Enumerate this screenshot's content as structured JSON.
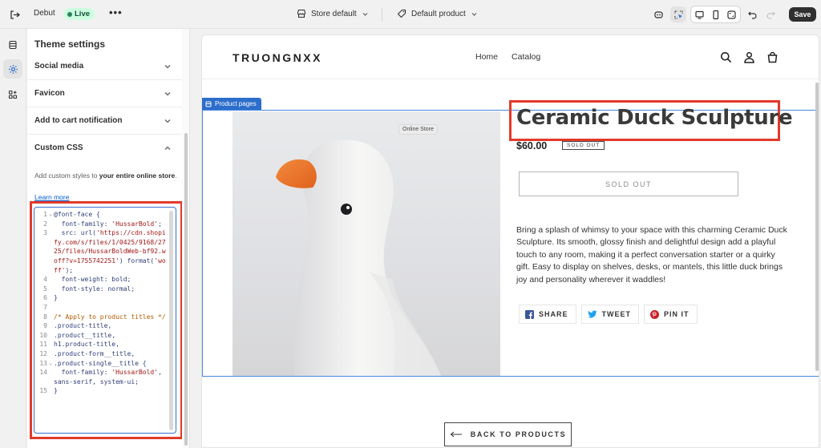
{
  "topbar": {
    "theme_name": "Debut",
    "live_badge": "Live",
    "more_label": "•••",
    "store_label": "Store default",
    "template_label": "Default product",
    "save_label": "Save"
  },
  "panel": {
    "title": "Theme settings",
    "sections": [
      "Social media",
      "Favicon",
      "Add to cart notification",
      "Custom CSS"
    ],
    "css_help_prefix": "Add custom styles to ",
    "css_help_bold": "your entire online store",
    "css_help_suffix": ".",
    "learn_more": "Learn more"
  },
  "code": [
    {
      "n": "1",
      "fold": "⌄",
      "text": "@font-face {"
    },
    {
      "n": "2",
      "fold": "",
      "text": "  font-family: 'HussarBold';"
    },
    {
      "n": "3",
      "fold": "",
      "text": "  src: url('https://cdn.shopify.com/s/files/1/0425/9168/2725/files/HussarBoldWeb-bf92.woff?v=1755742251') format('woff');"
    },
    {
      "n": "4",
      "fold": "",
      "text": "  font-weight: bold;"
    },
    {
      "n": "5",
      "fold": "",
      "text": "  font-style: normal;"
    },
    {
      "n": "6",
      "fold": "",
      "text": "}"
    },
    {
      "n": "7",
      "fold": "",
      "text": ""
    },
    {
      "n": "8",
      "fold": "",
      "text": "/* Apply to product titles */"
    },
    {
      "n": "9",
      "fold": "",
      "text": ".product-title,"
    },
    {
      "n": "10",
      "fold": "",
      "text": ".product__title,"
    },
    {
      "n": "11",
      "fold": "",
      "text": "h1.product-title,"
    },
    {
      "n": "12",
      "fold": "",
      "text": ".product-form__title,"
    },
    {
      "n": "13",
      "fold": "⌄",
      "text": ".product-single__title {"
    },
    {
      "n": "14",
      "fold": "",
      "text": "  font-family: 'HussarBold', sans-serif, system-ui;"
    },
    {
      "n": "15",
      "fold": "",
      "text": "}"
    }
  ],
  "store": {
    "brand": "TRUONGNXX",
    "nav": [
      "Home",
      "Catalog"
    ],
    "section_tag": "Product pages",
    "online_tooltip": "Online Store",
    "product_title": "Ceramic Duck Sculpture",
    "price": "$60.00",
    "sold_out_badge": "SOLD OUT",
    "sold_out_button": "SOLD OUT",
    "description": "Bring a splash of whimsy to your space with this charming Ceramic Duck Sculpture. Its smooth, glossy finish and delightful design add a playful touch to any room, making it a perfect conversation starter or a quirky gift. Easy to display on shelves, desks, or mantels, this little duck brings joy and personality wherever it waddles!",
    "share": [
      "SHARE",
      "TWEET",
      "PIN IT"
    ],
    "back": "BACK TO PRODUCTS"
  },
  "colors": {
    "highlight": "#e23a2a",
    "selection": "#2c6ecb",
    "live": "#29845a"
  }
}
